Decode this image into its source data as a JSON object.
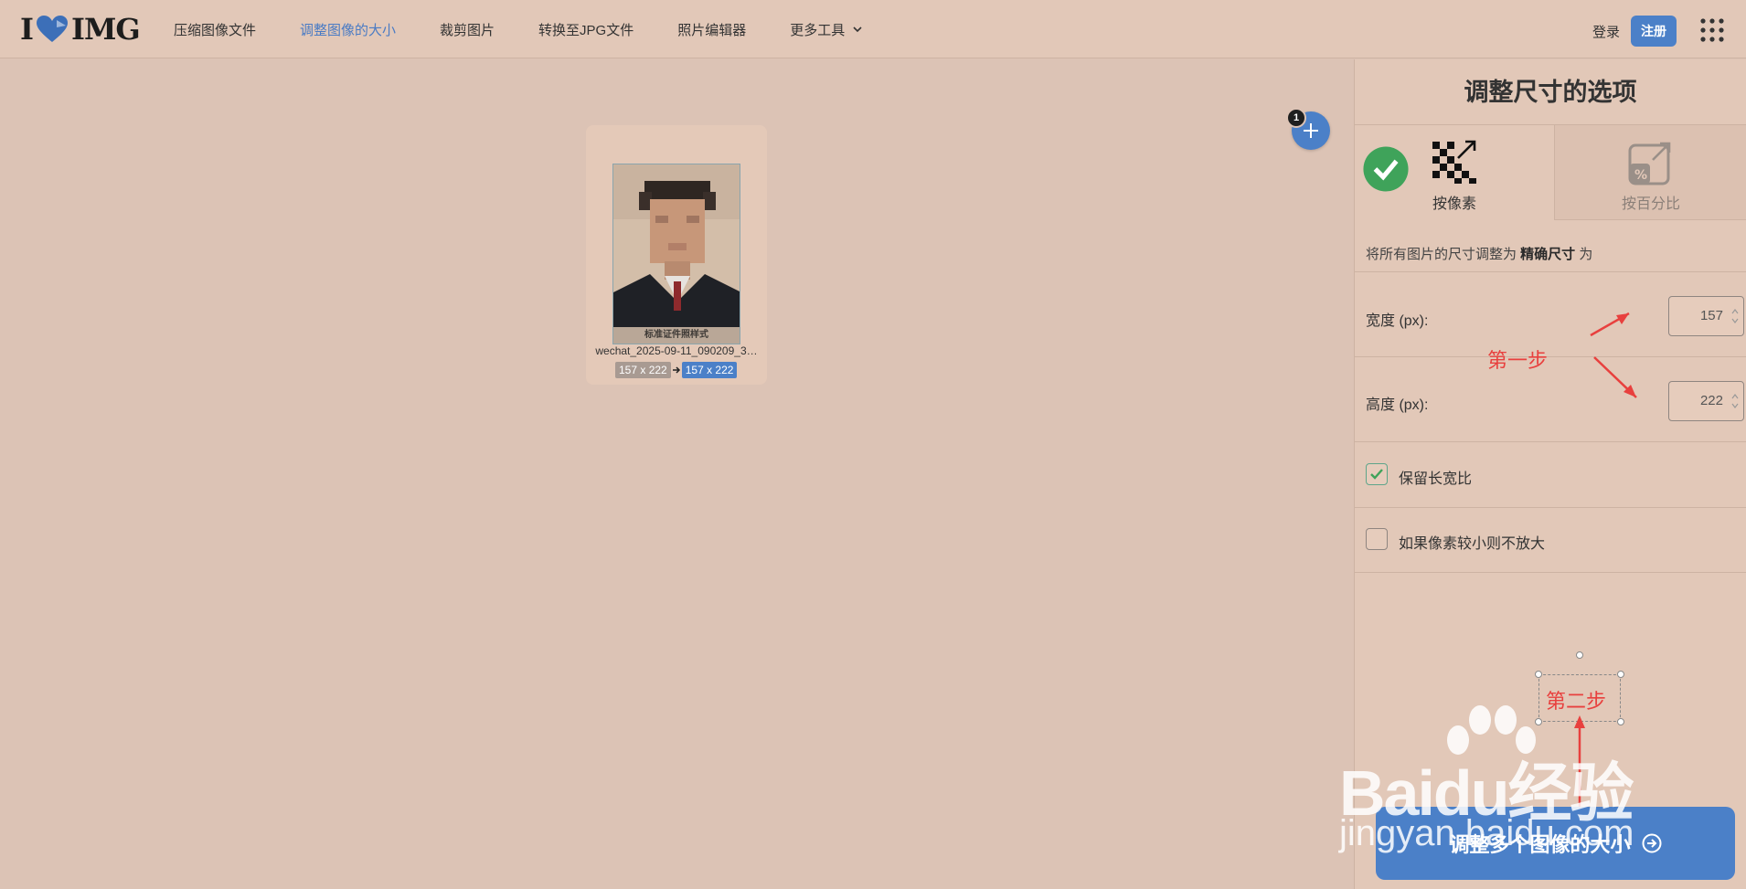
{
  "nav": {
    "logo_left": "I",
    "logo_right": "IMG",
    "items": [
      {
        "label": "压缩图像文件",
        "active": false
      },
      {
        "label": "调整图像的大小",
        "active": true
      },
      {
        "label": "裁剪图片",
        "active": false
      },
      {
        "label": "转换至JPG文件",
        "active": false
      },
      {
        "label": "照片编辑器",
        "active": false
      },
      {
        "label": "更多工具",
        "active": false
      }
    ],
    "login": "登录",
    "signup": "注册"
  },
  "workspace": {
    "file": {
      "name": "wechat_2025-09-11_090209_3…",
      "thumb_caption": "标准证件照样式",
      "orig_dims": "157 x 222",
      "new_dims": "157 x 222"
    },
    "file_count": "1"
  },
  "sidebar": {
    "title": "调整尺寸的选项",
    "tabs": {
      "pixels": "按像素",
      "percent": "按百分比"
    },
    "desc_prefix": "将所有图片的尺寸调整为 ",
    "desc_bold": "精确尺寸",
    "desc_suffix": " 为",
    "width_label": "宽度 (px):",
    "width_value": "157",
    "height_label": "高度 (px):",
    "height_value": "222",
    "keep_ratio_label": "保留长宽比",
    "keep_ratio_checked": true,
    "no_enlarge_label": "如果像素较小则不放大",
    "no_enlarge_checked": false,
    "submit_label": "调整多个图像的大小"
  },
  "annotations": {
    "step1": "第一步",
    "step2": "第二步"
  },
  "watermark": {
    "line1": "Baidu经验",
    "line2": "jingyan.baidu.com"
  },
  "colors": {
    "accent": "#4b80c8",
    "annotation_red": "#e8403e",
    "check_green": "#3fa35a"
  }
}
